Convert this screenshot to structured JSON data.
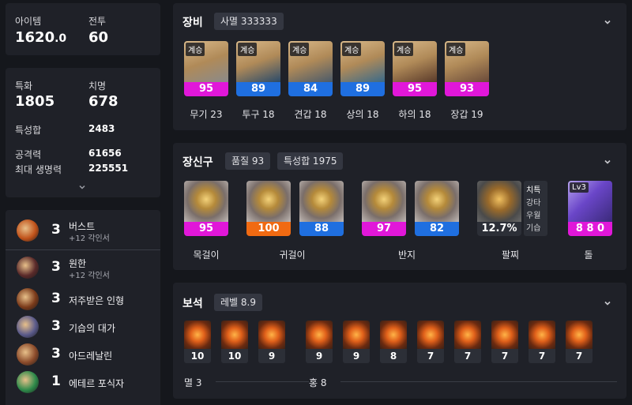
{
  "stats_top": {
    "item_label": "아이템",
    "item_value_int": "1620",
    "item_value_frac": ".0",
    "combat_label": "전투",
    "combat_value": "60"
  },
  "stats": {
    "special_label": "특화",
    "special_value": "1805",
    "crit_label": "치명",
    "crit_value": "678",
    "total_label": "특성합",
    "total_value": "2483",
    "atk_label": "공격력",
    "atk_value": "61656",
    "hp_label": "최대 생명력",
    "hp_value": "225551"
  },
  "engravings": [
    {
      "level": "3",
      "name": "버스트",
      "sub": "+12 각인서",
      "icon": "burst-icon",
      "color": "#c0521a"
    },
    {
      "level": "3",
      "name": "원한",
      "sub": "+12 각인서",
      "icon": "grudge-icon",
      "color": "#5a2a2a"
    },
    {
      "level": "3",
      "name": "저주받은 인형",
      "sub": "",
      "icon": "cursed-doll-icon",
      "color": "#7a3a1a"
    },
    {
      "level": "3",
      "name": "기습의 대가",
      "sub": "",
      "icon": "ambush-icon",
      "color": "#5a5a8a"
    },
    {
      "level": "3",
      "name": "아드레날린",
      "sub": "",
      "icon": "adrenaline-icon",
      "color": "#8a4a2a"
    },
    {
      "level": "1",
      "name": "에테르 포식자",
      "sub": "",
      "icon": "ether-icon",
      "color": "#2e8a4a"
    }
  ],
  "equipment": {
    "title": "장비",
    "chip": "사멸 333333",
    "items": [
      {
        "tag": "계승",
        "quality": "95",
        "name": "무기 23",
        "bar": "#e117d9",
        "icon": "weapon-icon"
      },
      {
        "tag": "계승",
        "quality": "89",
        "name": "투구 18",
        "bar": "#1f6fe0",
        "icon": "helmet-icon"
      },
      {
        "tag": "계승",
        "quality": "84",
        "name": "견갑 18",
        "bar": "#1f6fe0",
        "icon": "shoulder-icon"
      },
      {
        "tag": "계승",
        "quality": "89",
        "name": "상의 18",
        "bar": "#1f6fe0",
        "icon": "chest-icon"
      },
      {
        "tag": "계승",
        "quality": "95",
        "name": "하의 18",
        "bar": "#e117d9",
        "icon": "pants-icon"
      },
      {
        "tag": "계승",
        "quality": "93",
        "name": "장갑 19",
        "bar": "#e117d9",
        "icon": "gloves-icon"
      }
    ]
  },
  "accessories": {
    "title": "장신구",
    "chip1": "품질 93",
    "chip2": "특성합 1975",
    "items": [
      {
        "quality": "95",
        "bar": "#e117d9",
        "icon": "necklace-icon"
      },
      {
        "quality": "100",
        "bar": "#f06a12",
        "icon": "earring-icon"
      },
      {
        "quality": "88",
        "bar": "#1f6fe0",
        "icon": "earring-icon"
      },
      {
        "quality": "97",
        "bar": "#e117d9",
        "icon": "ring-icon"
      },
      {
        "quality": "82",
        "bar": "#1f6fe0",
        "icon": "ring-icon"
      }
    ],
    "labels": {
      "necklace": "목걸이",
      "earring": "귀걸이",
      "ring": "반지",
      "bracelet": "팔찌",
      "stone": "돌"
    },
    "bracelet": {
      "percent": "12.7%",
      "options": [
        "치특",
        "강타",
        "우월",
        "기습"
      ]
    },
    "stone": {
      "level": "Lv3",
      "value": "8 8 0"
    }
  },
  "gems": {
    "title": "보석",
    "chip": "레벨 8.9",
    "left": [
      "10",
      "10",
      "9"
    ],
    "right": [
      "9",
      "9",
      "8",
      "7",
      "7",
      "7",
      "7",
      "7"
    ],
    "left_label": "멸 3",
    "right_label": "홍 8"
  }
}
